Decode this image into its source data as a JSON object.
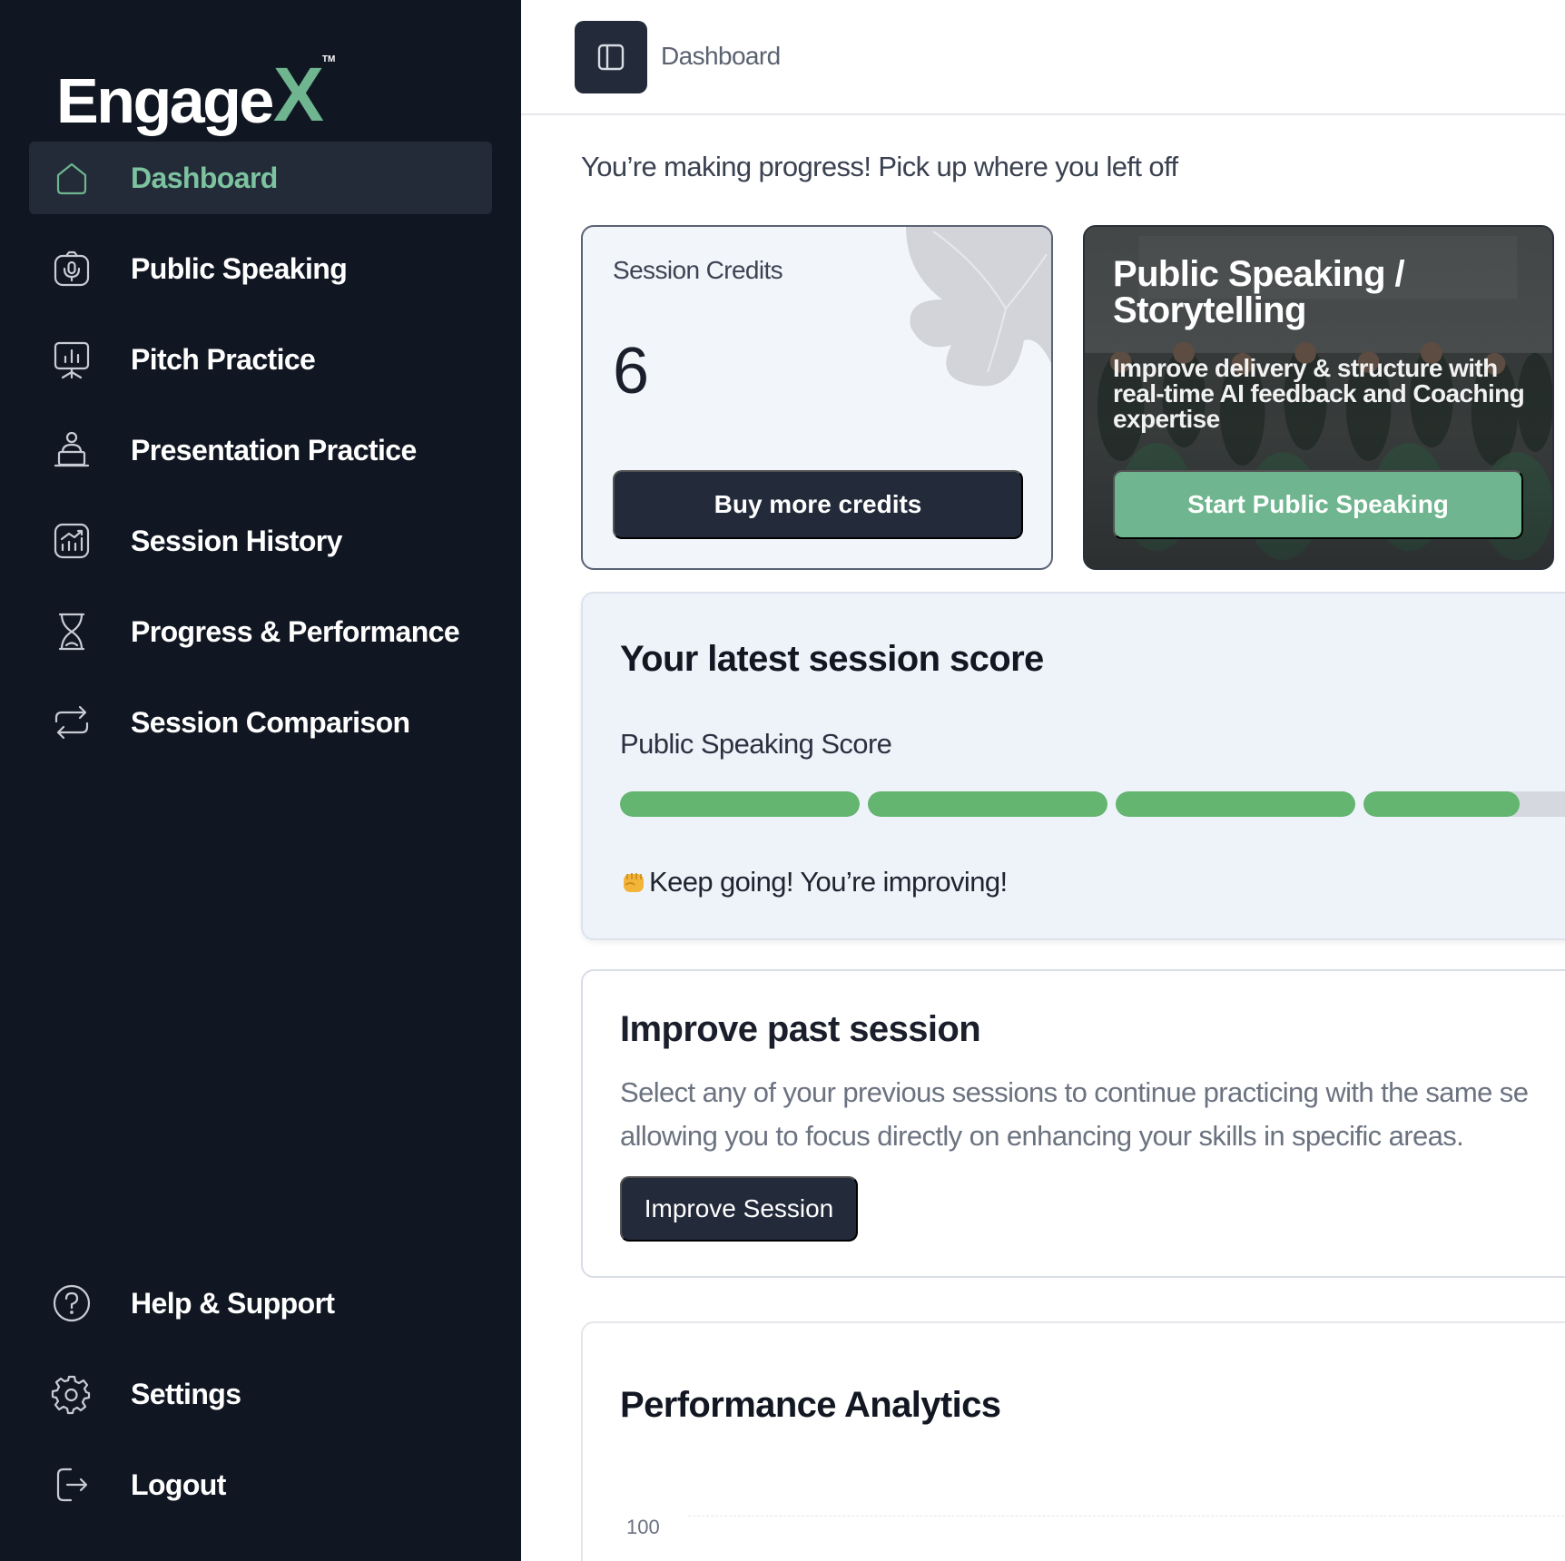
{
  "brand": {
    "logo_main": "Engage",
    "logo_accent": "X",
    "logo_tm": "TM"
  },
  "colors": {
    "sidebar_bg": "#111722",
    "accent_green": "#6fb58f",
    "dark_button": "#232a3a",
    "score_green": "#63b56f"
  },
  "sidebar": {
    "items": [
      {
        "label": "Dashboard",
        "icon": "home-icon",
        "active": true
      },
      {
        "label": "Public Speaking",
        "icon": "microphone-icon"
      },
      {
        "label": "Pitch Practice",
        "icon": "presentation-board-icon"
      },
      {
        "label": "Presentation Practice",
        "icon": "presenter-icon"
      },
      {
        "label": "Session History",
        "icon": "chart-history-icon"
      },
      {
        "label": "Progress & Performance",
        "icon": "hourglass-icon"
      },
      {
        "label": "Session Comparison",
        "icon": "repeat-icon"
      }
    ],
    "bottom_items": [
      {
        "label": "Help & Support",
        "icon": "help-circle-icon"
      },
      {
        "label": "Settings",
        "icon": "gear-icon"
      },
      {
        "label": "Logout",
        "icon": "logout-icon"
      }
    ]
  },
  "header": {
    "toggle_icon": "sidebar-toggle-icon",
    "breadcrumb": "Dashboard"
  },
  "main": {
    "progress_message": "You’re making progress! Pick up where you left off",
    "credits": {
      "title": "Session Credits",
      "value": "6",
      "button": "Buy more credits"
    },
    "public_speaking_card": {
      "title": "Public Speaking / Storytelling",
      "description": "Improve delivery & structure with real-time AI feedback and Coaching expertise",
      "button": "Start Public Speaking"
    },
    "latest_score": {
      "heading": "Your latest session score",
      "subheading": "Public Speaking Score",
      "segment_fills": [
        1,
        1,
        1,
        0.65
      ],
      "note": "Keep going! You’re improving!"
    },
    "improve": {
      "heading": "Improve past session",
      "description_line1": "Select any of your previous sessions to continue practicing with the same se",
      "description_line2": "allowing you to focus directly on enhancing your skills in specific areas.",
      "button": "Improve Session"
    },
    "analytics": {
      "heading": "Performance Analytics",
      "y_tick": "100"
    }
  }
}
